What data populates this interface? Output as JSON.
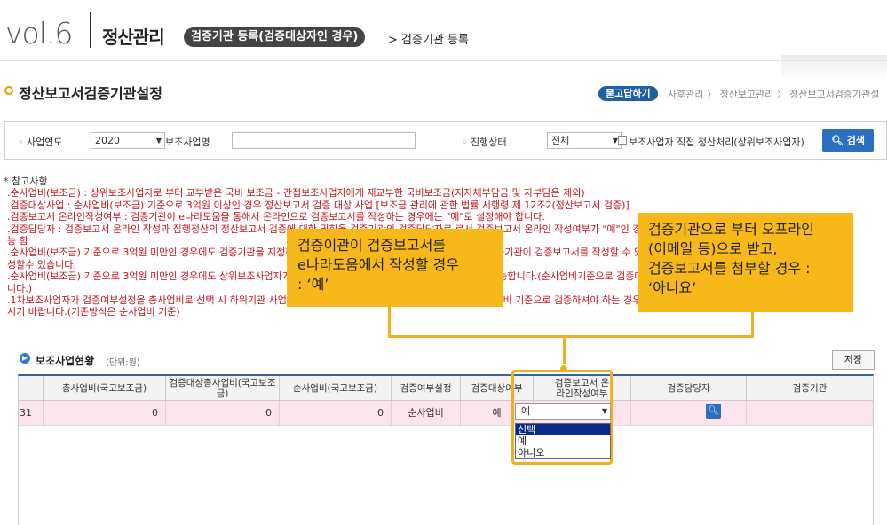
{
  "banner": {
    "vol": "vol.6",
    "category": "정산관리",
    "pill": "검증기관 등록(검증대상자인 경우)",
    "tail": "> 검증기관 등록"
  },
  "header": {
    "title": "정산보고서검증기관설정",
    "help": "묻고답하기",
    "breadcrumb": "사후관리 〉 정산보고관리 〉 정산보고서검증기관설"
  },
  "search": {
    "year_label": "사업연도",
    "year_value": "2020",
    "sub_label": "보조사업명",
    "sub_value": "",
    "status_label": "진행상태",
    "status_value": "전체",
    "check_label": "보조사업자 직접 정산처리(상위보조사업자)",
    "button": "검색"
  },
  "notes": {
    "title": "* 참고사항",
    "lines": [
      ".순사업비(보조금) : 상위보조사업자로 부터 교부받은 국비 보조금 - 간접보조사업자에게 재교부한 국비보조금(지자체부담금 및 자부담은 제외)",
      ".검증대상사업 : 순사업비(보조금) 기준으로 3억원 이상인 경우 정산보고서 검증 대상 사업 [보조금 관리에 관한 법률 시행령 제 12조2(정산보고서 검증)]",
      ".검증보고서 온라인작성여부 : 검증기관이 e나라도움을 통해서 온라인으로 검증보고서를 작성하는 경우에는 \"예\"로 설정해야 합니다.",
      ".검증담당자 : 검증보고서 온라인 작성과 집행정산의 정산보고서 검증에 대한 권한을 검증기관의 검증담당자로 로서 검증보고서 온라인 작성여부가 \"예\"인 경우에만 지정이 가",
      "능 함",
      ".순사업비(보조금) 기준으로 3억원 미만인 경우에도 검증기관을 지정하려면 검증여부설정 항목에서 \"예\" 로 선택하면, 검증기관이 검증보고서를 작성할 수 있는 권한을 부여받아 검증보고서를 작",
      "성할수 있습니다.",
      ".순사업비(보조금) 기준으로 3억원 미만인 경우에도 상위보조사업자가 검증여부를 설정하는 경우에만 검증기관 지정이 가능합니다.(순사업비기준으로 검증대상여부가 설정된 경우에는 'N'입",
      "니다.)",
      ".1차보조사업자가 검증여부설정을 총사업비로 선택 시 하위기관 사업이 모두 검증대상여부가 \"예\"로 바뀌게 됩니다.총사업비 기준으로 검증하셔야 하는 경우만 선택 후 저장하여주",
      "시기 바랍니다.(기존방식은 순사업비 기준)"
    ]
  },
  "callouts": {
    "left": [
      "검증이관이 검증보고서를",
      "e나라도움에서 작성할 경우",
      ": ‘예’"
    ],
    "right": [
      "검증기관으로 부터 오프라인",
      "(이메일 등)으로 받고,",
      "검증보고서를 첨부할 경우 :",
      "‘아니요’"
    ]
  },
  "list": {
    "title": "보조사업현황",
    "unit": "(단위:원)",
    "save": "저장"
  },
  "table": {
    "headers": [
      "총사업비(국고보조금)",
      "검증대상총사업비(국고보조금)",
      "순사업비(국고보조금)",
      "검증여부설정",
      "검증대상여부",
      "검증보고서 온라인작성여부",
      "검증담당자",
      "검증기관"
    ],
    "row": {
      "index": "31",
      "total": "0",
      "verify_total": "0",
      "net": "0",
      "setting": "순사업비",
      "target": "예",
      "online": "예"
    }
  },
  "dropdown": {
    "options": [
      "선택",
      "예",
      "아니오"
    ],
    "highlight_index": 0
  }
}
